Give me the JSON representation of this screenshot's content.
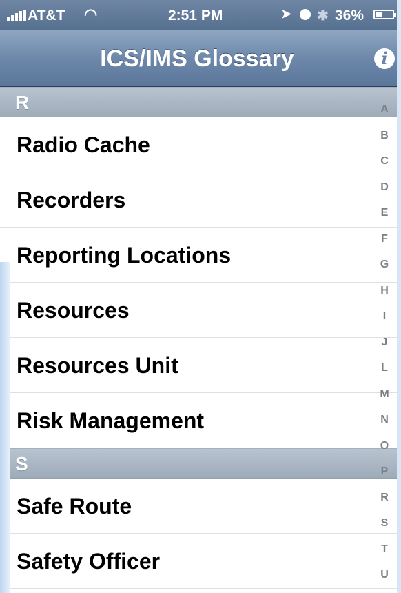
{
  "status_bar": {
    "carrier": "AT&T",
    "time": "2:51 PM",
    "battery": "36%"
  },
  "nav": {
    "title": "ICS/IMS Glossary",
    "info_label": "i"
  },
  "sections": [
    {
      "letter": "R",
      "items": [
        "Radio Cache",
        "Recorders",
        "Reporting Locations",
        "Resources",
        "Resources Unit",
        "Risk Management"
      ]
    },
    {
      "letter": "S",
      "items": [
        "Safe Route",
        "Safety Officer"
      ]
    }
  ],
  "index_letters": [
    "A",
    "B",
    "C",
    "D",
    "E",
    "F",
    "G",
    "H",
    "I",
    "J",
    "L",
    "M",
    "N",
    "O",
    "P",
    "R",
    "S",
    "T",
    "U"
  ]
}
